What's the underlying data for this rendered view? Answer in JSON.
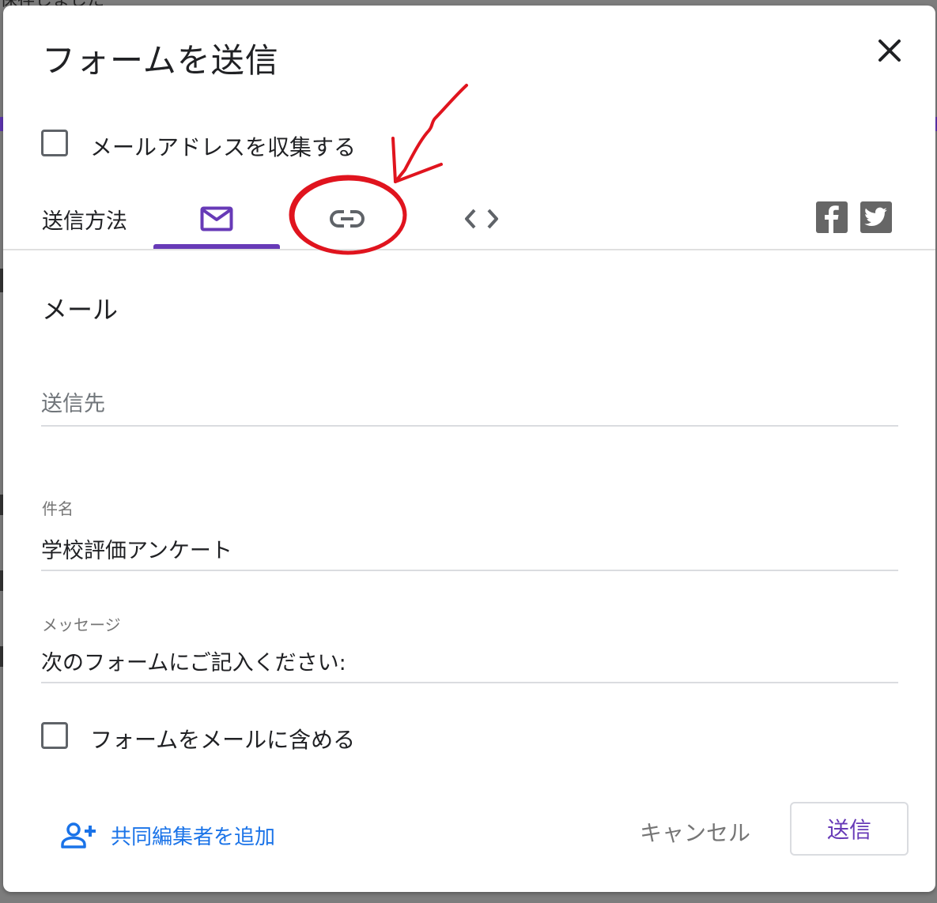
{
  "background": {
    "top_text": "保存しました"
  },
  "dialog": {
    "title": "フォームを送信",
    "close_icon": "close-icon"
  },
  "collect_email": {
    "label": "メールアドレスを収集する",
    "checked": false
  },
  "send_via": {
    "label": "送信方法",
    "tabs": [
      {
        "icon": "mail-icon",
        "selected": true
      },
      {
        "icon": "link-icon",
        "selected": false
      },
      {
        "icon": "embed-code-icon",
        "selected": false
      }
    ],
    "social": [
      {
        "icon": "facebook-icon"
      },
      {
        "icon": "twitter-icon"
      }
    ]
  },
  "email_section": {
    "title": "メール",
    "to": {
      "placeholder": "送信先",
      "value": ""
    },
    "subject": {
      "label": "件名",
      "value": "学校評価アンケート"
    },
    "message": {
      "label": "メッセージ",
      "value": "次のフォームにご記入ください:"
    },
    "include_form": {
      "label": "フォームをメールに含める",
      "checked": false
    }
  },
  "footer": {
    "add_collaborators_label": "共同編集者を追加",
    "add_collaborators_icon": "person-add-icon",
    "cancel_label": "キャンセル",
    "send_label": "送信"
  },
  "colors": {
    "accent": "#673ab7",
    "link": "#1a73e8",
    "annotation": "#e0141e"
  }
}
